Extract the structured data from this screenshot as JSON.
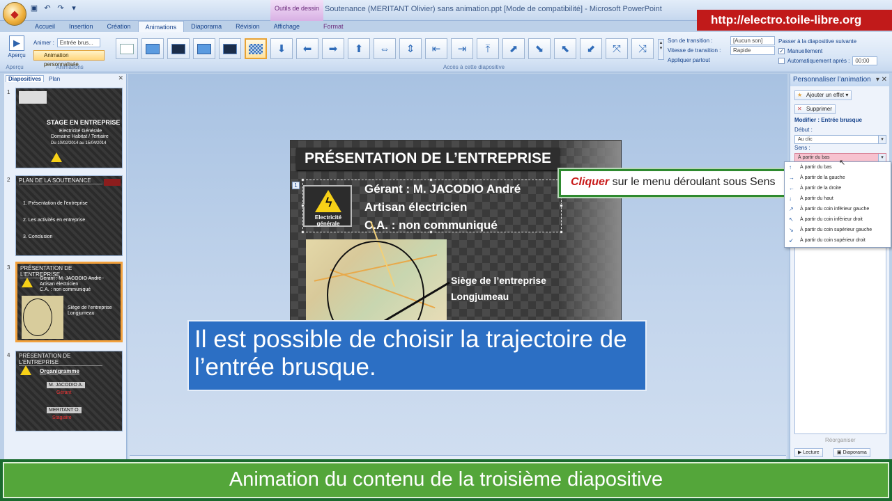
{
  "window": {
    "title": "Soutenance (MERITANT Olivier) sans animation.ppt [Mode de compatibilité] - Microsoft PowerPoint",
    "context_tab_group": "Outils de dessin"
  },
  "url_banner": "http://electro.toile-libre.org",
  "tabs": [
    {
      "label": "Accueil"
    },
    {
      "label": "Insertion"
    },
    {
      "label": "Création"
    },
    {
      "label": "Animations"
    },
    {
      "label": "Diaporama"
    },
    {
      "label": "Révision"
    },
    {
      "label": "Affichage"
    },
    {
      "label": "Format"
    }
  ],
  "ribbon": {
    "apercu_label": "Aperçu",
    "apercu_group": "Aperçu",
    "animer_label": "Animer :",
    "animer_value": "Entrée brus...",
    "anim_perso_label": "Animation personnalisée",
    "animations_group": "Animations",
    "transitions_group": "Accès à cette diapositive",
    "son_label": "Son de transition :",
    "son_value": "[Aucun son]",
    "vitesse_label": "Vitesse de transition :",
    "vitesse_value": "Rapide",
    "appliquer_label": "Appliquer partout",
    "passer_label": "Passer à la diapositive suivante",
    "manuellement_label": "Manuellement",
    "auto_label": "Automatiquement après :",
    "auto_value": "00:00"
  },
  "left_panel": {
    "tab_slides": "Diapositives",
    "tab_plan": "Plan",
    "slides": [
      {
        "num": "1",
        "title": "STAGE EN ENTREPRISE",
        "lines": [
          "Electricité Générale",
          "Domaine Habitat / Tertiaire",
          "Du 10/02/2014 au 15/04/2014"
        ]
      },
      {
        "num": "2",
        "title": "PLAN DE LA SOUTENANCE",
        "lines": [
          "1. Présentation de l'entreprise",
          "2. Les activités en entreprise",
          "3. Conclusion"
        ]
      },
      {
        "num": "3",
        "title": "PRÉSENTATION DE L'ENTREPRISE",
        "lines": [
          "Gérant : M. JACODIO André",
          "Artisan électricien",
          "C.A. : non communiqué",
          "Siège de l'entreprise",
          "Longjumeau"
        ]
      },
      {
        "num": "4",
        "title": "PRÉSENTATION DE L'ENTREPRISE",
        "lines": [
          "Organigramme",
          "M. JACODIO A.",
          "Gérant",
          "MERITANT O.",
          "Stagiaire"
        ]
      }
    ]
  },
  "slide": {
    "title": "PRÉSENTATION DE L’ENTREPRISE",
    "gerant": "Gérant : M. JACODIO André",
    "artisan": "Artisan électricien",
    "ca": "C.A. : non communiqué",
    "logo_text": "Electricité générale",
    "siege_line1": "Siège de l’entreprise",
    "siege_line2": "Longjumeau",
    "anim_tag": "1"
  },
  "callouts": {
    "green_red": "Cliquer",
    "green_rest": " sur le menu déroulant sous Sens",
    "blue_text": "Il est possible de choisir la trajectoire de l’entrée brusque."
  },
  "right_panel": {
    "title": "Personnaliser l’animation",
    "ajouter": "Ajouter un effet",
    "supprimer": "Supprimer",
    "modifier": "Modifier : Entrée brusque",
    "debut_label": "Début :",
    "debut_value": "Au clic",
    "sens_label": "Sens :",
    "sens_value": "À partir du bas",
    "reorganiser": "Réorganiser",
    "lecture": "Lecture",
    "diaporama": "Diaporama",
    "dropdown": [
      "À partir du bas",
      "À partir de la gauche",
      "À partir de la droite",
      "À partir du haut",
      "À partir du coin inférieur gauche",
      "À partir du coin inférieur droit",
      "À partir du coin supérieur gauche",
      "À partir du coin supérieur droit"
    ]
  },
  "footer": "Animation du contenu de la troisième diapositive"
}
